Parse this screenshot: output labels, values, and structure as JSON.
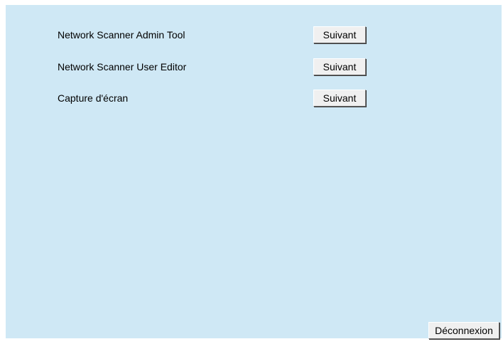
{
  "items": [
    {
      "label": "Network Scanner Admin Tool",
      "button": "Suivant"
    },
    {
      "label": "Network Scanner User Editor",
      "button": "Suivant"
    },
    {
      "label": "Capture d'écran",
      "button": "Suivant"
    }
  ],
  "logout_label": "Déconnexion",
  "colors": {
    "panel_background": "#cfe8f5",
    "button_face": "#f0f0f0"
  }
}
